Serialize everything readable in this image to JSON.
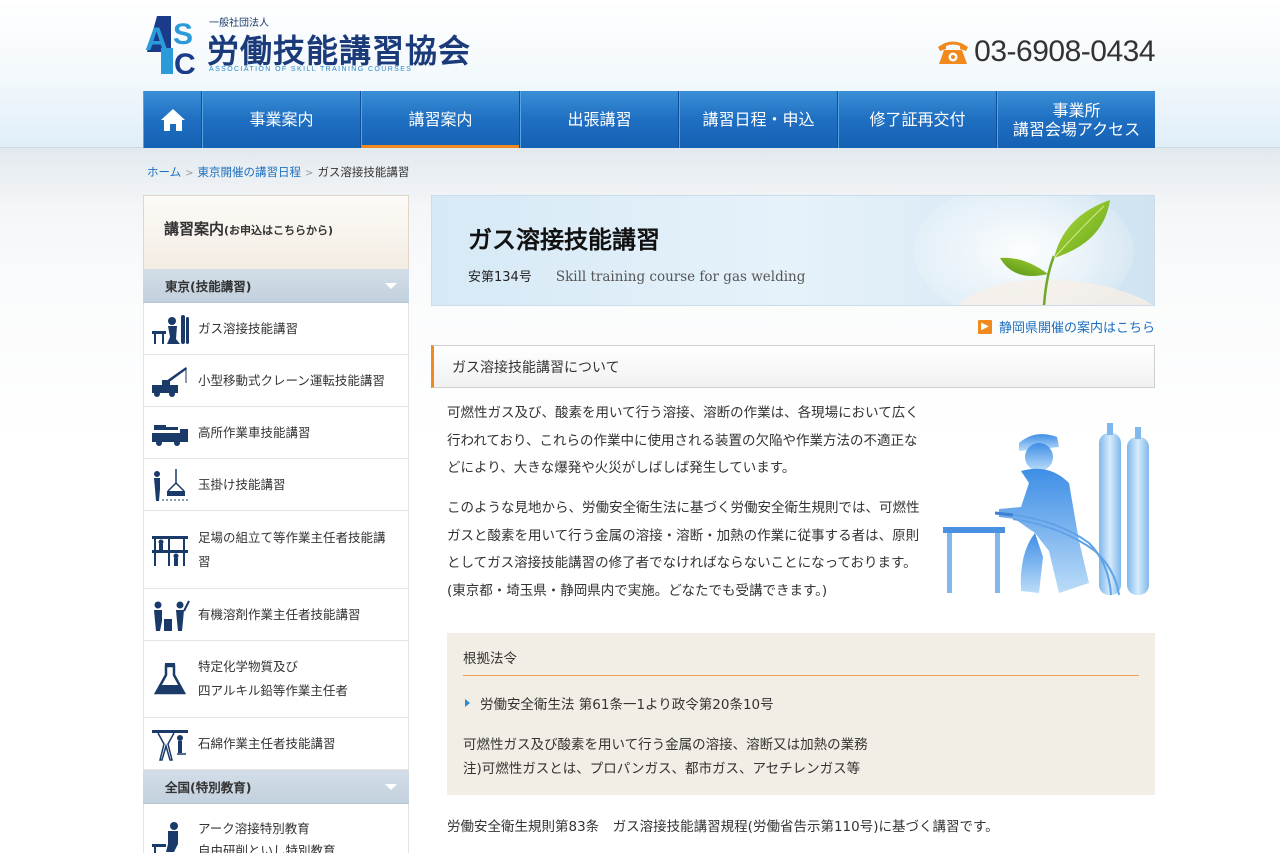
{
  "header": {
    "logo_small": "一般社団法人",
    "logo_name": "労働技能講習協会",
    "logo_en": "ASSOCIATION OF SKILL TRAINING COURSES",
    "phone": "03-6908-0434"
  },
  "nav": {
    "items": [
      {
        "label": "事業案内"
      },
      {
        "label": "講習案内"
      },
      {
        "label": "出張講習"
      },
      {
        "label": "講習日程・申込"
      },
      {
        "label": "修了証再交付"
      },
      {
        "label_line1": "事業所",
        "label_line2": "講習会場アクセス"
      }
    ]
  },
  "breadcrumb": {
    "home": "ホーム",
    "parent": "東京開催の講習日程",
    "current": "ガス溶接技能講習",
    "sep": ">"
  },
  "sidebar": {
    "title": "講習案内",
    "title_note": "(お申込はこちらから)",
    "cat_tokyo": "東京(技能講習)",
    "tokyo_items": [
      {
        "line1": "ガス溶接技能講習"
      },
      {
        "line1": "小型移動式クレーン運転技能講習"
      },
      {
        "line1": "高所作業車技能講習"
      },
      {
        "line1": "玉掛け技能講習"
      },
      {
        "line1": "足場の組立て等作業主任者技能講",
        "line2": "習"
      },
      {
        "line1": "有機溶剤作業主任者技能講習"
      },
      {
        "line1": "特定化学物質及び",
        "line2": "四アルキル鉛等作業主任者"
      },
      {
        "line1": "石綿作業主任者技能講習"
      }
    ],
    "cat_national": "全国(特別教育)",
    "national_items": [
      {
        "line1": "アーク溶接特別教育",
        "line2": "自由研削といし特別教育"
      }
    ]
  },
  "hero": {
    "title": "ガス溶接技能講習",
    "code": "安第134号",
    "english": "Skill training course for gas welding"
  },
  "main": {
    "shizuoka_link": "静岡県開催の案内はこちら",
    "section_title": "ガス溶接技能講習について",
    "p1": "可燃性ガス及び、酸素を用いて行う溶接、溶断の作業は、各現場において広く行われており、これらの作業中に使用される装置の欠陥や作業方法の不適正などにより、大きな爆発や火災がしばしば発生しています。",
    "p2": "このような見地から、労働安全衛生法に基づく労働安全衛生規則では、可燃性ガスと酸素を用いて行う金属の溶接・溶断・加熱の作業に従事する者は、原則としてガス溶接技能講習の修了者でなければならないことになっております。(東京都・埼玉県・静岡県内で実施。どなたでも受講できます。)",
    "law_title": "根拠法令",
    "law_item": "労働安全衛生法 第61条一1より政令第20条10号",
    "law_desc1": "可燃性ガス及び酸素を用いて行う金属の溶接、溶断又は加熱の業務",
    "law_desc2": "注)可燃性ガスとは、プロパンガス、都市ガス、アセチレンガス等",
    "footer_note": "労働安全衛生規則第83条　ガス溶接技能講習規程(労働省告示第110号)に基づく講習です。"
  },
  "colors": {
    "nav_blue": "#1f6fc2",
    "accent_orange": "#f08a1e",
    "link_blue": "#1c6fc0",
    "law_bg": "#f3eee5"
  }
}
